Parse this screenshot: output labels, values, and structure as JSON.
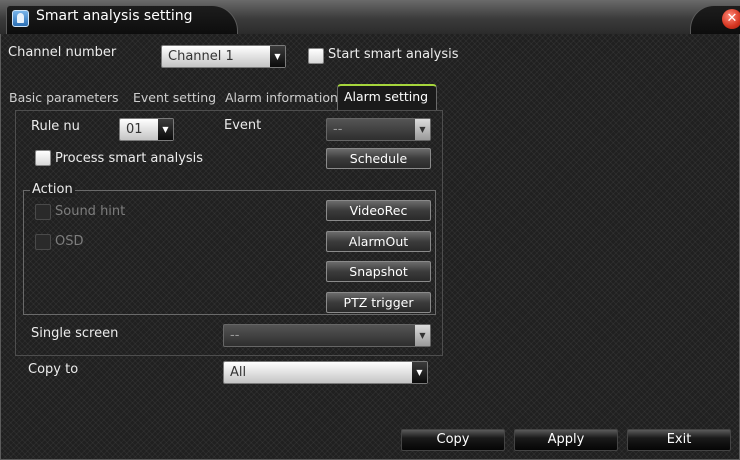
{
  "window": {
    "title": "Smart analysis setting",
    "close_glyph": "✕"
  },
  "channel": {
    "label": "Channel number",
    "selected": "Channel 1"
  },
  "start_smart_analysis": {
    "label": "Start smart analysis",
    "checked": false
  },
  "tabs": [
    {
      "label": "Basic parameters",
      "active": false
    },
    {
      "label": "Event setting",
      "active": false
    },
    {
      "label": "Alarm information",
      "active": false
    },
    {
      "label": "Alarm setting",
      "active": true
    }
  ],
  "rule": {
    "label": "Rule nu",
    "selected": "01"
  },
  "event": {
    "label": "Event",
    "selected": "--"
  },
  "process": {
    "label": "Process smart analysis",
    "checked": false
  },
  "schedule_button": "Schedule",
  "action": {
    "label": "Action",
    "sound_hint": "Sound hint",
    "osd": "OSD",
    "buttons": {
      "videorec": "VideoRec",
      "alarmout": "AlarmOut",
      "snapshot": "Snapshot",
      "ptz": "PTZ trigger"
    }
  },
  "single_screen": {
    "label": "Single screen",
    "selected": "--"
  },
  "copy_to": {
    "label": "Copy to",
    "selected": "All"
  },
  "footer": {
    "copy": "Copy",
    "apply": "Apply",
    "exit": "Exit"
  },
  "icons": {
    "window": "camera-icon",
    "close": "close-icon",
    "dropdown": "chevron-down-icon"
  },
  "colors": {
    "active_tab_accent": "#a6d63c",
    "close_button": "#d4341f",
    "title_icon": "#2b6fb4"
  }
}
